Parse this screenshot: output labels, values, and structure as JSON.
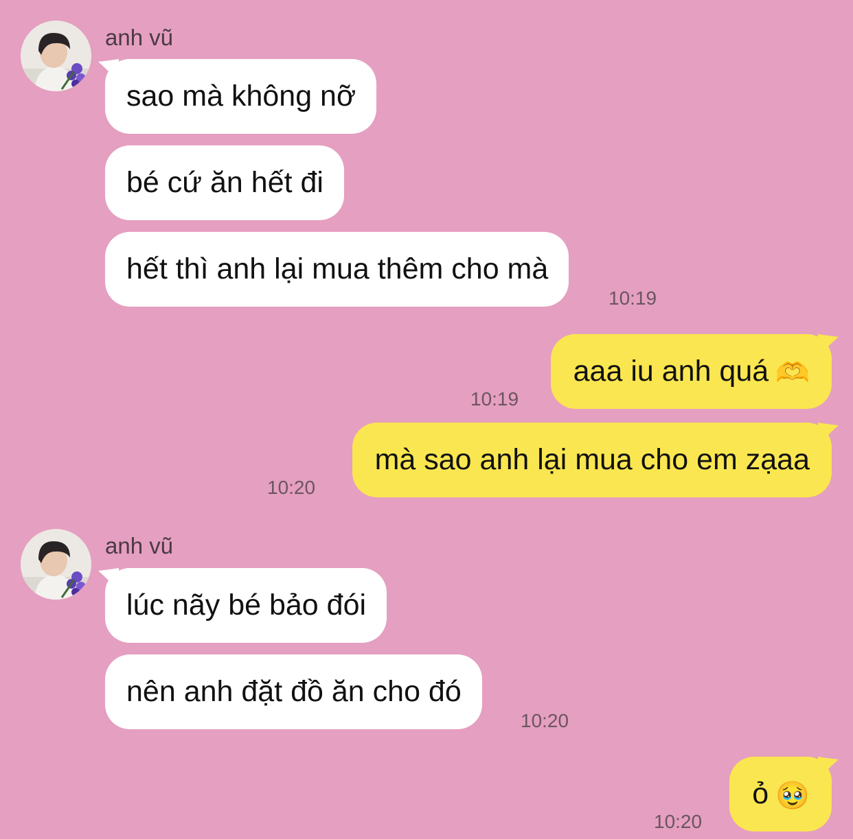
{
  "colors": {
    "background": "#e59fc0",
    "incoming_bubble": "#ffffff",
    "outgoing_bubble": "#fae650",
    "text": "#111111",
    "meta_text": "#6b5560"
  },
  "messages": [
    {
      "sender": "anh vũ",
      "avatar_icon": "profile-photo-avatar",
      "direction": "incoming",
      "bubbles": [
        "sao mà không nỡ",
        "bé cứ ăn hết đi",
        "hết thì anh lại mua thêm cho mà"
      ],
      "time": "10:19"
    },
    {
      "direction": "outgoing",
      "text": "aaa iu anh quá",
      "emoji": "🫶",
      "emoji_icon": "heart-hands-emoji",
      "time": "10:19"
    },
    {
      "direction": "outgoing",
      "text": "mà sao anh lại mua cho em zạaa",
      "time": "10:20"
    },
    {
      "sender": "anh vũ",
      "avatar_icon": "profile-photo-avatar",
      "direction": "incoming",
      "bubbles": [
        "lúc nãy bé bảo đói",
        "nên anh đặt đồ ăn cho đó"
      ],
      "time": "10:20"
    },
    {
      "direction": "outgoing",
      "text": "ỏ",
      "emoji": "🥹",
      "emoji_icon": "holding-back-tears-emoji",
      "time": "10:20"
    }
  ]
}
